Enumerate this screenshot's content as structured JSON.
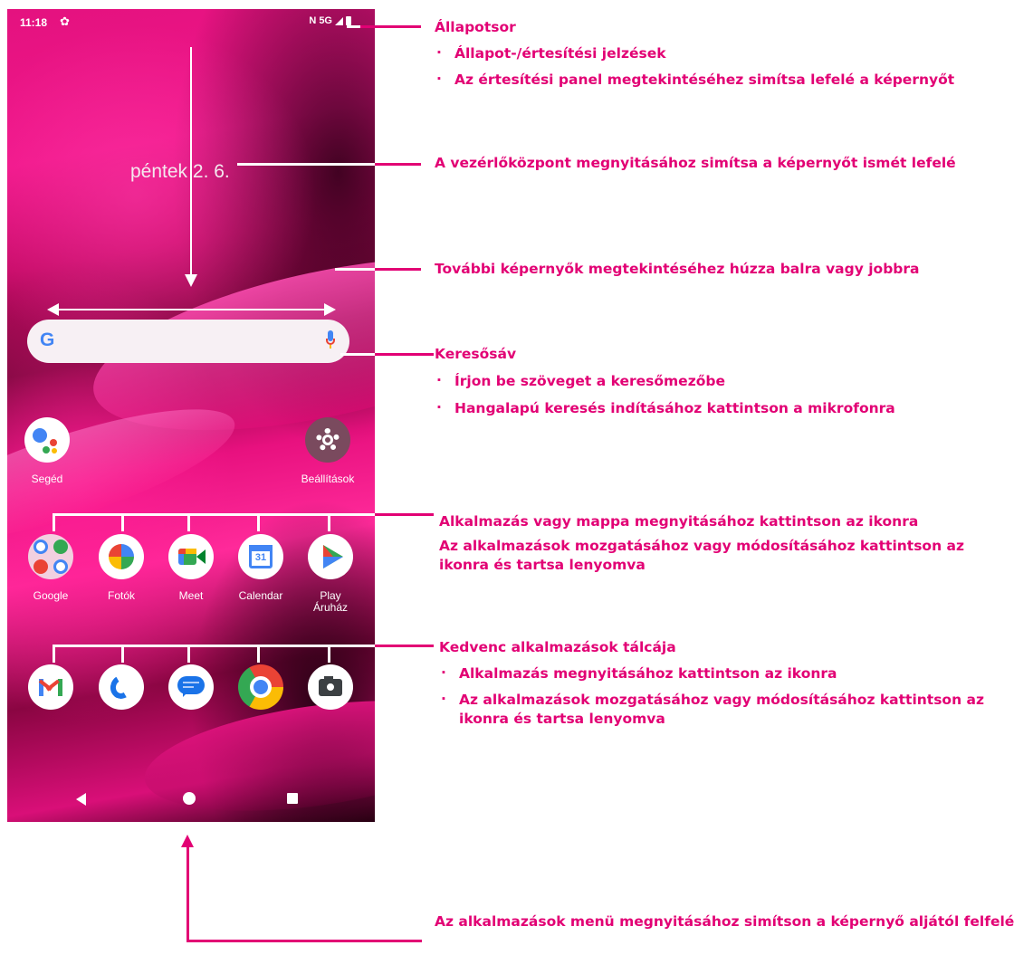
{
  "status_bar": {
    "time": "11:18",
    "network": "N 5G"
  },
  "lock": {
    "date": "péntek 2. 6."
  },
  "search_bar": {
    "logo": "G"
  },
  "apps": {
    "assistant": "Segéd",
    "settings": "Beállítások",
    "row": [
      "Google",
      "Fotók",
      "Meet",
      "Calendar",
      "Play Áruház"
    ],
    "calendar_day": "31"
  },
  "dock": [
    "Gmail",
    "Phone",
    "Messages",
    "Chrome",
    "Camera"
  ],
  "callouts": {
    "status_bar": {
      "title": "Állapotsor",
      "bullets": [
        "Állapot-/értesítési jelzések",
        "Az értesítési panel megtekintéséhez simítsa lefelé a képernyőt"
      ]
    },
    "control_center": "A vezérlőközpont megnyitásához simítsa a képernyőt ismét lefelé",
    "swipe_screens": "További képernyők megtekintéséhez húzza balra vagy jobbra",
    "search": {
      "title": "Keresősáv",
      "bullets": [
        "Írjon be szöveget a keresőmezőbe",
        "Hangalapú keresés indításához kattintson a mikrofonra"
      ]
    },
    "apps": {
      "line1": "Alkalmazás vagy mappa megnyitásához kattintson az ikonra",
      "line2": "Az alkalmazások mozgatásához vagy módosításához kattintson az ikonra és tartsa lenyomva"
    },
    "favorites": {
      "title": "Kedvenc alkalmazások tálcája",
      "bullets": [
        "Alkalmazás megnyitásához kattintson az ikonra",
        "Az alkalmazások mozgatásához vagy módosításához kattintson az ikonra és tartsa lenyomva"
      ]
    },
    "app_drawer": "Az alkalmazások menü megnyitásához simítson a képernyő aljától felfelé"
  },
  "colors": {
    "accent": "#e20074",
    "search_bg": "#f7f0f4"
  }
}
